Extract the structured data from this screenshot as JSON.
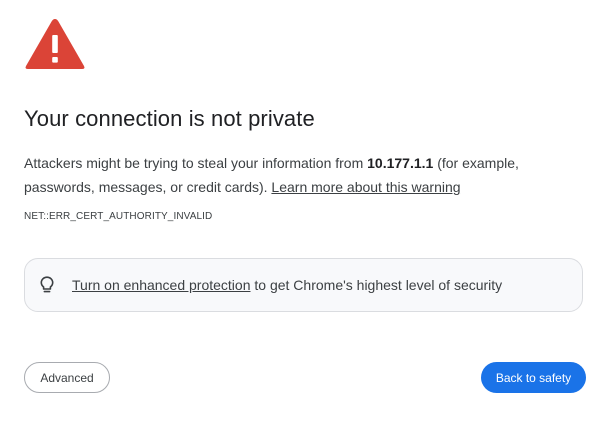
{
  "title": "Your connection is not private",
  "body": {
    "prefix": "Attackers might be trying to steal your information from ",
    "host": "10.177.1.1",
    "suffix": " (for example, passwords, messages, or credit cards). ",
    "learn_more": "Learn more about this warning"
  },
  "error_code": "NET::ERR_CERT_AUTHORITY_INVALID",
  "enhanced_protection": {
    "icon": "lightbulb-icon",
    "link": "Turn on enhanced protection",
    "rest": " to get Chrome's highest level of security"
  },
  "buttons": {
    "advanced": "Advanced",
    "back": "Back to safety"
  },
  "colors": {
    "warning": "#db4437",
    "primary": "#1a73e8"
  }
}
